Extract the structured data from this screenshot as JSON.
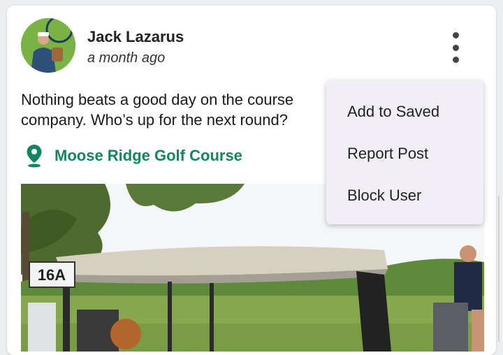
{
  "post": {
    "author_name": "Jack Lazarus",
    "timestamp": "a month ago",
    "text_line1": "Nothing beats a good day on the course",
    "text_line2": "company. Who’s up for the next round?",
    "location_label": "Moose Ridge Golf Course",
    "location_icon": "map-pin-icon",
    "more_icon": "more-vertical-icon",
    "photo_sign_label": "16A"
  },
  "menu": {
    "items": [
      {
        "label": "Add to Saved"
      },
      {
        "label": "Report Post"
      },
      {
        "label": "Block User"
      }
    ]
  },
  "colors": {
    "accent": "#148561",
    "menu_bg": "#f2eef6",
    "card_bg": "#ffffff"
  }
}
